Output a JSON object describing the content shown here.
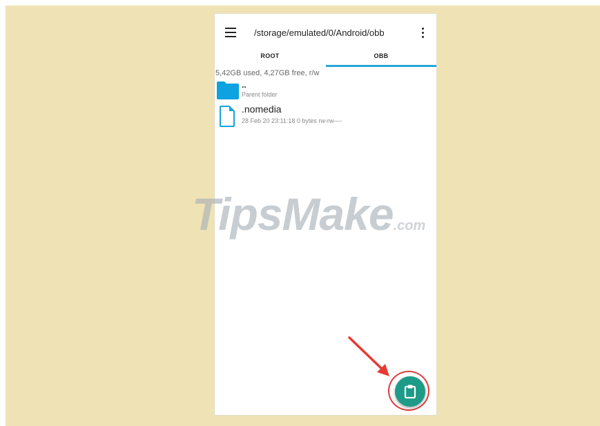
{
  "toolbar": {
    "path": "/storage/emulated/0/Android/obb",
    "menu_icon": "hamburger-menu-icon",
    "overflow_icon": "vertical-dots-icon"
  },
  "tabs": [
    {
      "label": "ROOT",
      "selected": false
    },
    {
      "label": "OBB",
      "selected": true
    }
  ],
  "storage_info": "5,42GB used, 4,27GB free, r/w",
  "entries": [
    {
      "name": "..",
      "details": "Parent folder",
      "icon": "folder-icon"
    },
    {
      "name": ".nomedia",
      "details": "28 Feb 20 23:11:18  0 bytes  rw-rw----",
      "icon": "file-icon"
    }
  ],
  "watermark": {
    "main": "TipsMake",
    "suffix": ".com"
  },
  "fab": {
    "icon": "clipboard-paste-icon"
  },
  "colors": {
    "accent": "#26a6d9",
    "fab": "#1e9a88",
    "highlight": "#dc3b3b",
    "background": "#efe3b5"
  }
}
